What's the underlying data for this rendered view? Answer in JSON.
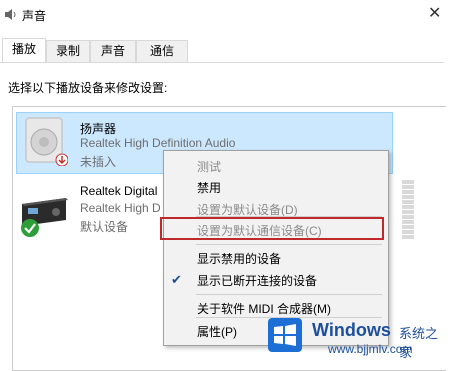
{
  "window": {
    "title": "声音",
    "close_glyph": "✕"
  },
  "tabs": [
    {
      "label": "播放",
      "active": true
    },
    {
      "label": "录制",
      "active": false
    },
    {
      "label": "声音",
      "active": false
    },
    {
      "label": "通信",
      "active": false
    }
  ],
  "prompt": "选择以下播放设备来修改设置:",
  "devices": [
    {
      "name": "扬声器",
      "description": "Realtek High Definition Audio",
      "status": "未插入",
      "icon": "speaker-icon",
      "status_icon": "down-arrow-badge-icon",
      "selected": true
    },
    {
      "name": "Realtek Digital",
      "description": "Realtek High D",
      "status": "默认设备",
      "icon": "receiver-icon",
      "status_icon": "green-check-icon",
      "selected": false
    }
  ],
  "context_menu": {
    "items": [
      {
        "label": "测试",
        "disabled": true
      },
      {
        "label": "禁用",
        "disabled": false
      },
      {
        "label": "设置为默认设备(D)",
        "disabled": true
      },
      {
        "label": "设置为默认通信设备(C)",
        "disabled": true,
        "highlighted": true
      },
      {
        "label": "显示禁用的设备",
        "disabled": false
      },
      {
        "label": "显示已断开连接的设备",
        "disabled": false,
        "checked": true
      },
      {
        "label": "关于软件 MIDI 合成器(M)",
        "disabled": false
      },
      {
        "label": "属性(P)",
        "disabled": false
      }
    ],
    "check_glyph": "✔"
  },
  "watermark": {
    "title": "Windows",
    "subtitle": "系统之家",
    "url": "www.bjjmlv.com"
  },
  "colors": {
    "selection": "#cce8ff",
    "highlight_border": "#c0282a",
    "watermark": "#1d4f9c"
  }
}
